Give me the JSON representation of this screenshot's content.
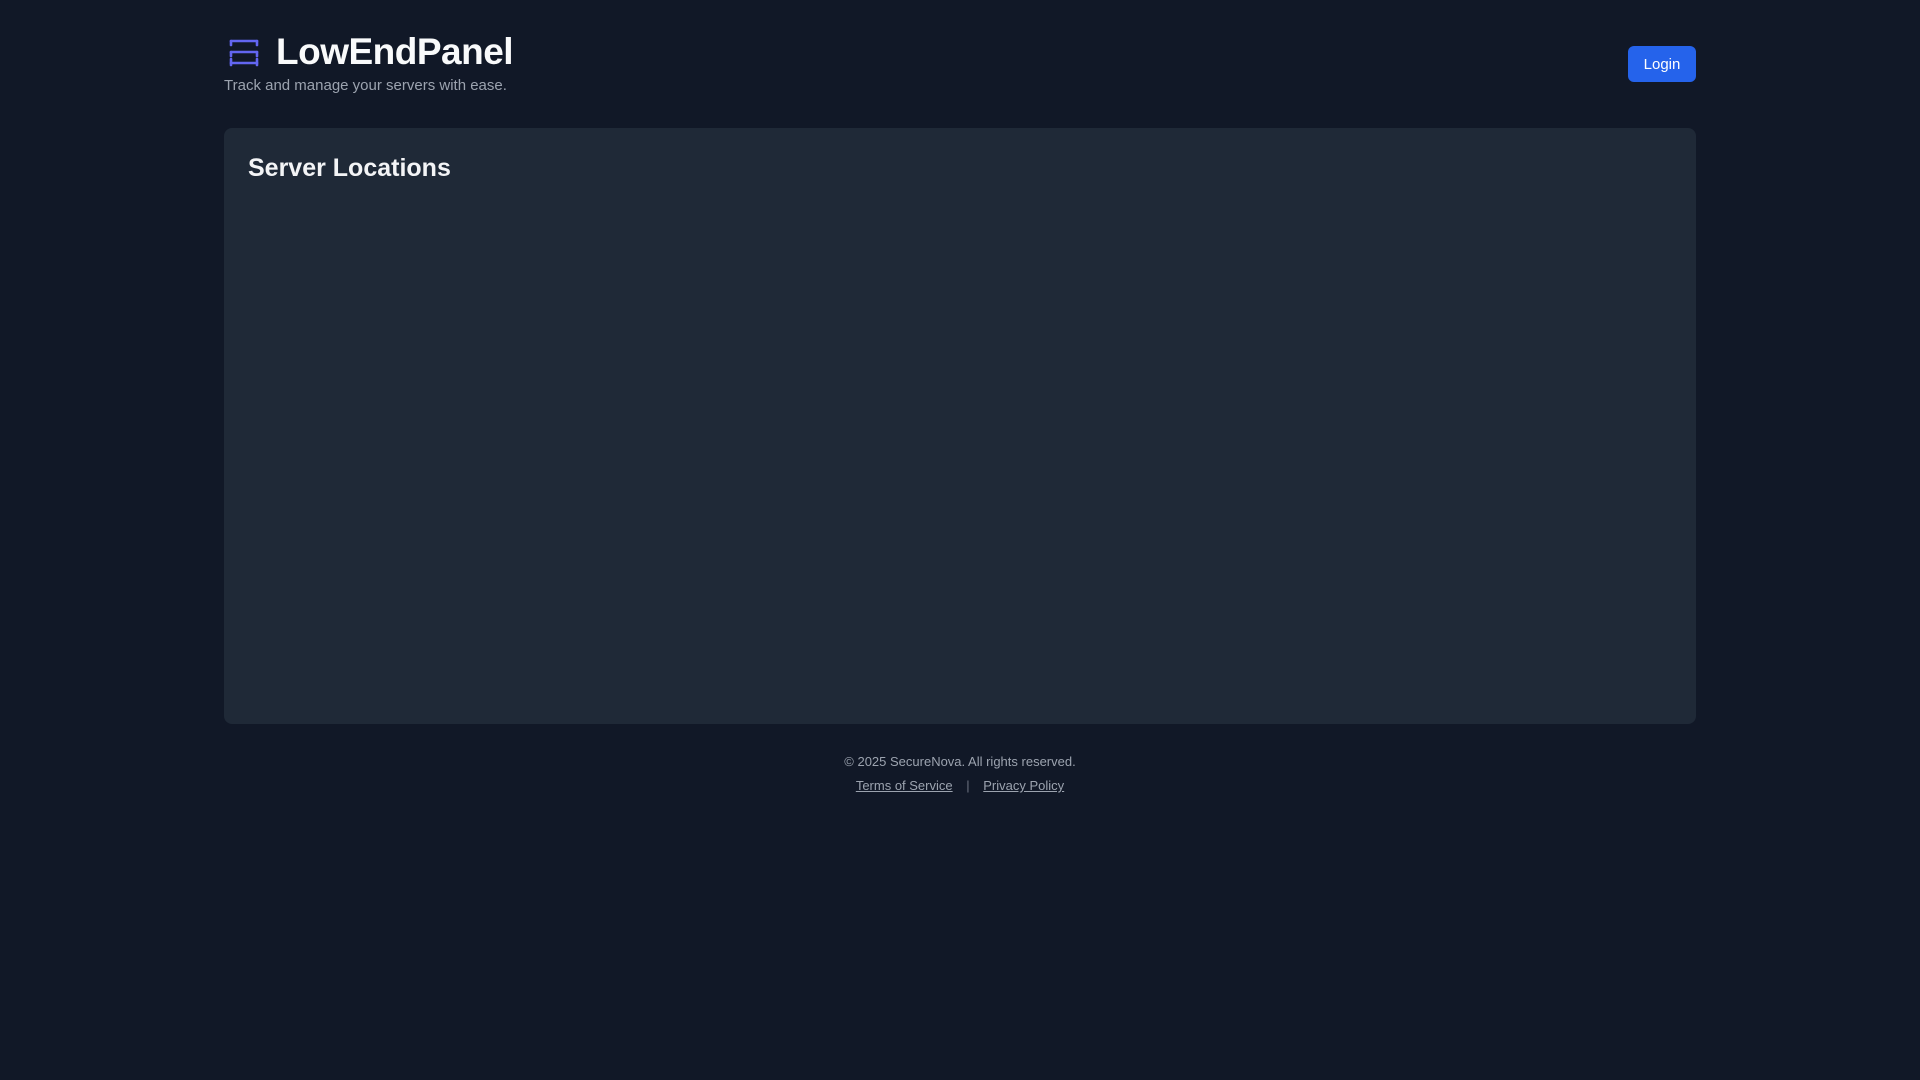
{
  "header": {
    "title": "LowEndPanel",
    "tagline": "Track and manage your servers with ease.",
    "login_label": "Login",
    "icon": "server-stack-icon"
  },
  "main": {
    "card_title": "Server Locations"
  },
  "footer": {
    "copyright": "© 2025 SecureNova. All rights reserved.",
    "terms_label": "Terms of Service",
    "separator": "|",
    "privacy_label": "Privacy Policy"
  },
  "colors": {
    "background": "#111827",
    "card": "#1f2937",
    "accent": "#2563eb",
    "icon": "#6366f1"
  }
}
